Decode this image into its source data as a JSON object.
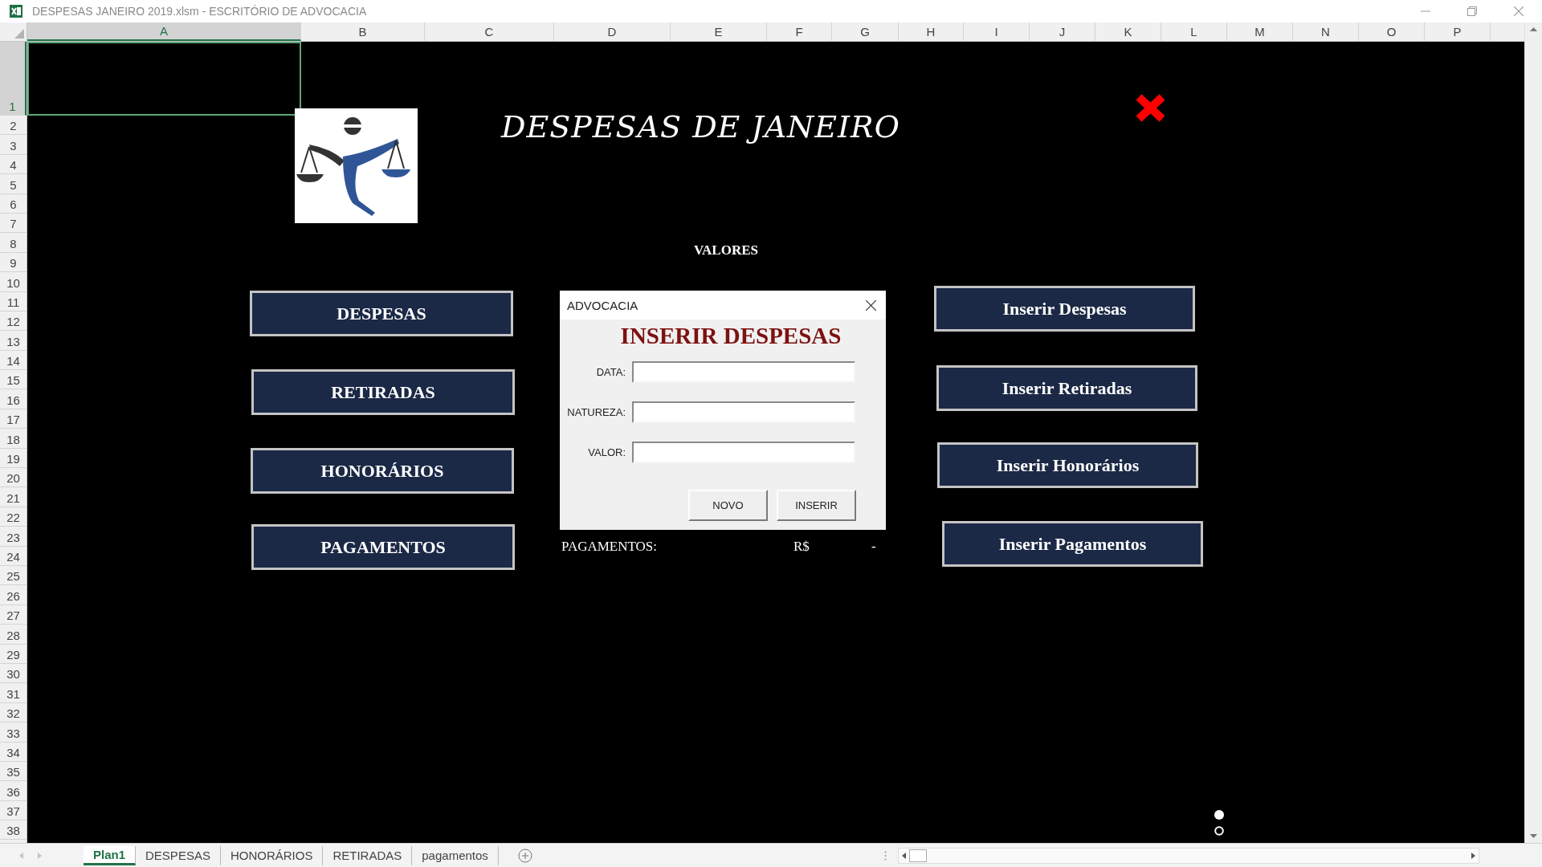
{
  "window": {
    "title": "DESPESAS JANEIRO 2019.xlsm - ESCRITÓRIO DE ADVOCACIA"
  },
  "columns": [
    {
      "label": "A",
      "selected": true
    },
    {
      "label": "B",
      "selected": false
    },
    {
      "label": "C",
      "selected": false
    },
    {
      "label": "D",
      "selected": false
    },
    {
      "label": "E",
      "selected": false
    },
    {
      "label": "F",
      "selected": false
    },
    {
      "label": "G",
      "selected": false
    },
    {
      "label": "H",
      "selected": false
    },
    {
      "label": "I",
      "selected": false
    },
    {
      "label": "J",
      "selected": false
    },
    {
      "label": "K",
      "selected": false
    },
    {
      "label": "L",
      "selected": false
    },
    {
      "label": "M",
      "selected": false
    },
    {
      "label": "N",
      "selected": false
    },
    {
      "label": "O",
      "selected": false
    },
    {
      "label": "P",
      "selected": false
    }
  ],
  "rows": [
    {
      "label": "1",
      "selected": true
    },
    {
      "label": "2",
      "selected": false
    },
    {
      "label": "3",
      "selected": false
    },
    {
      "label": "4",
      "selected": false
    },
    {
      "label": "5",
      "selected": false
    },
    {
      "label": "6",
      "selected": false
    },
    {
      "label": "7",
      "selected": false
    },
    {
      "label": "8",
      "selected": false
    },
    {
      "label": "9",
      "selected": false
    },
    {
      "label": "10",
      "selected": false
    },
    {
      "label": "11",
      "selected": false
    },
    {
      "label": "12",
      "selected": false
    },
    {
      "label": "13",
      "selected": false
    },
    {
      "label": "14",
      "selected": false
    },
    {
      "label": "15",
      "selected": false
    },
    {
      "label": "16",
      "selected": false
    },
    {
      "label": "17",
      "selected": false
    },
    {
      "label": "18",
      "selected": false
    },
    {
      "label": "19",
      "selected": false
    },
    {
      "label": "20",
      "selected": false
    },
    {
      "label": "21",
      "selected": false
    },
    {
      "label": "22",
      "selected": false
    },
    {
      "label": "23",
      "selected": false
    },
    {
      "label": "24",
      "selected": false
    },
    {
      "label": "25",
      "selected": false
    },
    {
      "label": "26",
      "selected": false
    },
    {
      "label": "27",
      "selected": false
    },
    {
      "label": "28",
      "selected": false
    },
    {
      "label": "29",
      "selected": false
    },
    {
      "label": "30",
      "selected": false
    },
    {
      "label": "31",
      "selected": false
    },
    {
      "label": "32",
      "selected": false
    },
    {
      "label": "33",
      "selected": false
    },
    {
      "label": "34",
      "selected": false
    },
    {
      "label": "35",
      "selected": false
    },
    {
      "label": "36",
      "selected": false
    },
    {
      "label": "37",
      "selected": false
    },
    {
      "label": "38",
      "selected": false
    }
  ],
  "sheet": {
    "title": "DESPESAS DE JANEIRO",
    "section_label": "VALORES",
    "left_buttons": [
      "DESPESAS",
      "RETIRADAS",
      "HONORÁRIOS",
      "PAGAMENTOS"
    ],
    "right_buttons": [
      "Inserir Despesas",
      "Inserir Retiradas",
      "Inserir Honorários",
      "Inserir Pagamentos"
    ],
    "summary": {
      "label": "PAGAMENTOS:",
      "currency": "R$",
      "value": "-"
    }
  },
  "dialog": {
    "title": "ADVOCACIA",
    "heading": "INSERIR DESPESAS",
    "fields": [
      {
        "label": "DATA:"
      },
      {
        "label": "NATUREZA:"
      },
      {
        "label": "VALOR:"
      }
    ],
    "buttons": [
      "NOVO",
      "INSERIR"
    ]
  },
  "sheet_tabs": [
    {
      "label": "Plan1",
      "selected": true
    },
    {
      "label": "DESPESAS",
      "selected": false
    },
    {
      "label": "HONORÁRIOS",
      "selected": false
    },
    {
      "label": "RETIRADAS",
      "selected": false
    },
    {
      "label": "pagamentos",
      "selected": false
    }
  ]
}
